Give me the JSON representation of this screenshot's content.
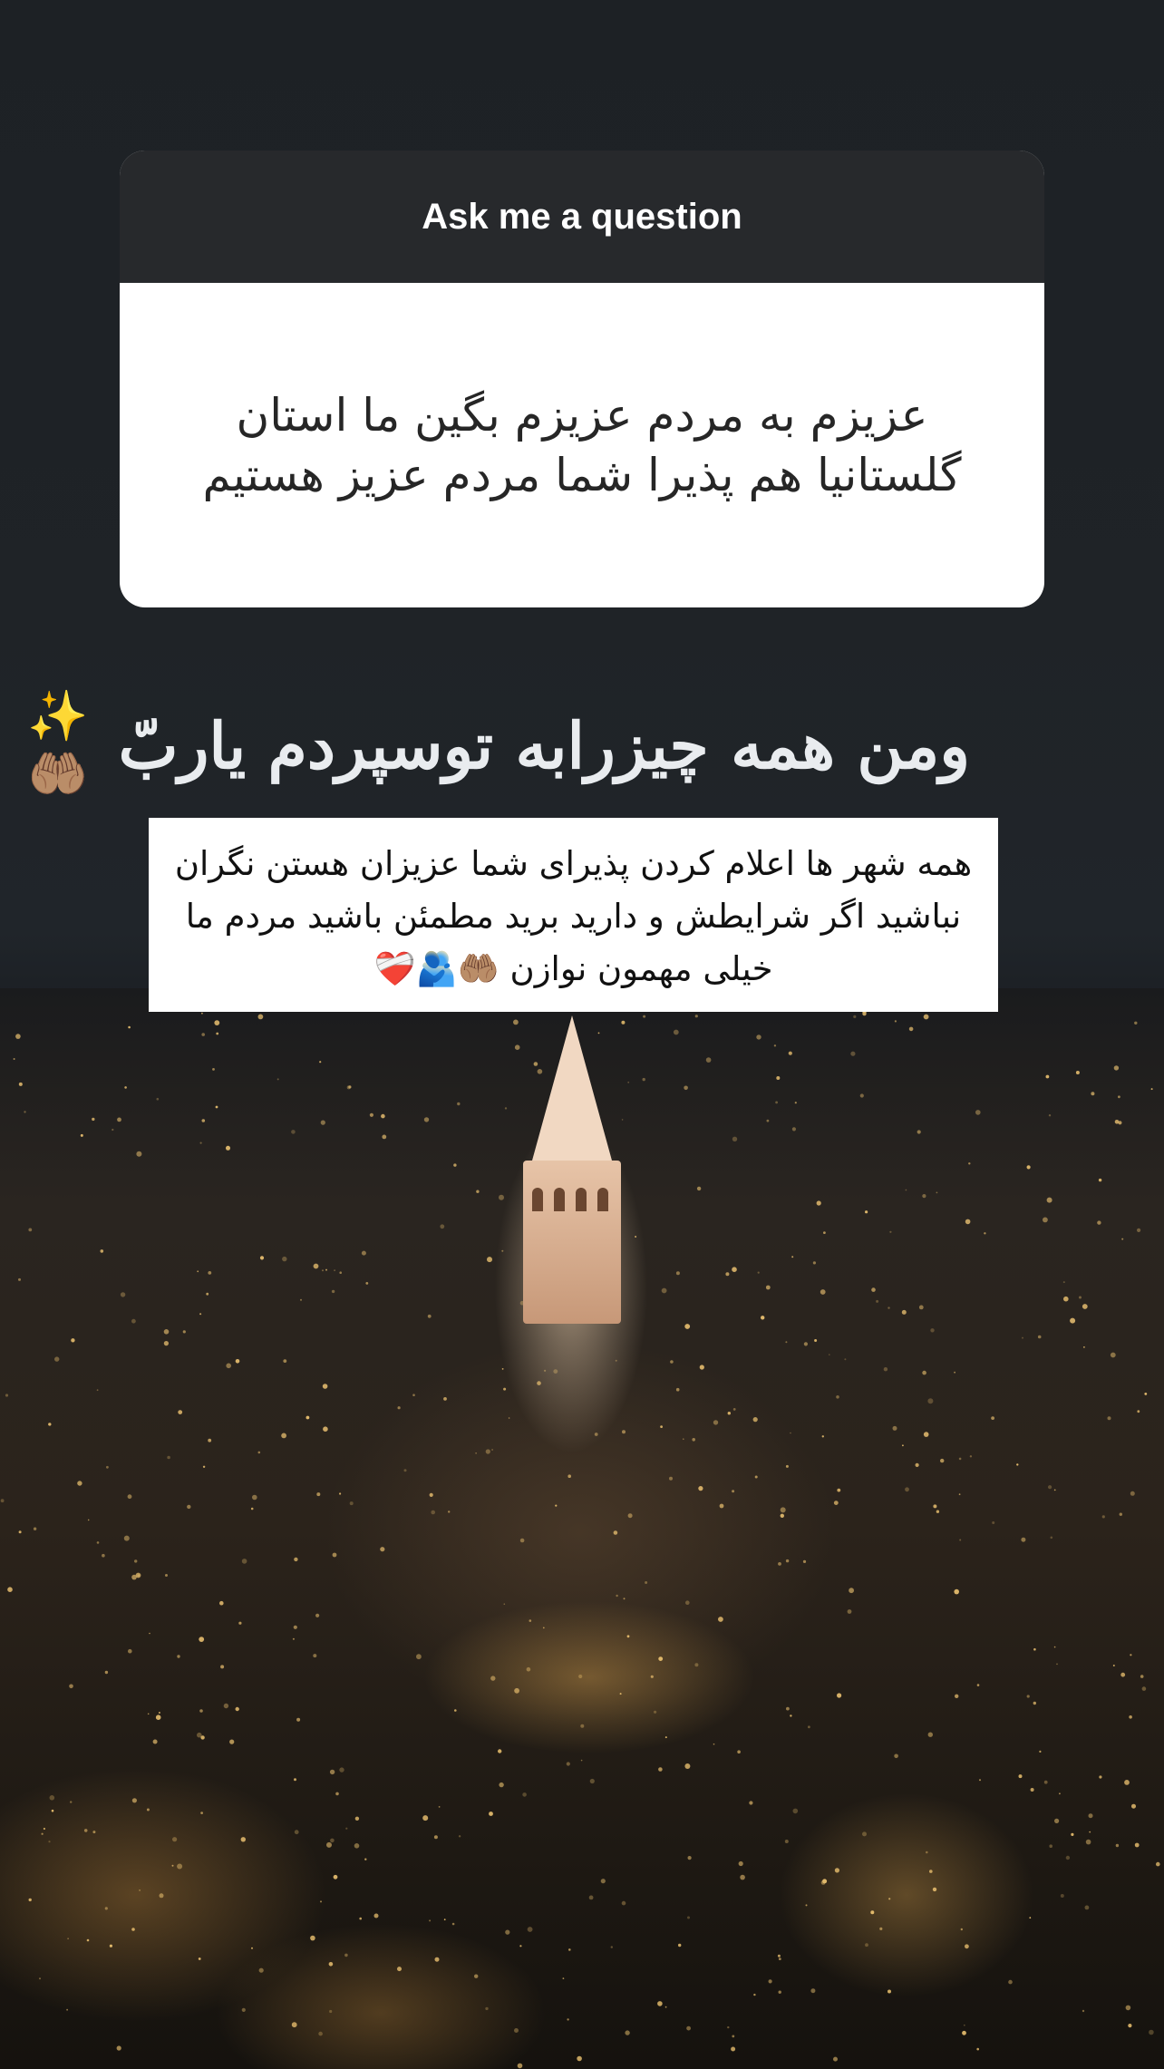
{
  "question_card": {
    "header": "Ask me a question",
    "answer": "عزیزم به مردم عزیزم بگین ما استان گلستانیا هم پذیرا شما مردم عزیز هستیم"
  },
  "caption": {
    "text": "ومن همه چیزرابه توسپردم یاربّ",
    "emoji": "✨🤲🏽"
  },
  "note": {
    "text": "همه شهر ها اعلام کردن پذیرای شما عزیزان هستن نگران نباشید اگر شرایطش و دارید برید مطمئن باشید مردم ما خیلی مهمون نوازن",
    "emoji": "❤️‍🩹🫂🤲🏽"
  },
  "colors": {
    "card_header_bg": "#27292c",
    "card_body_bg": "#ffffff",
    "background_top": "#1d2125"
  }
}
